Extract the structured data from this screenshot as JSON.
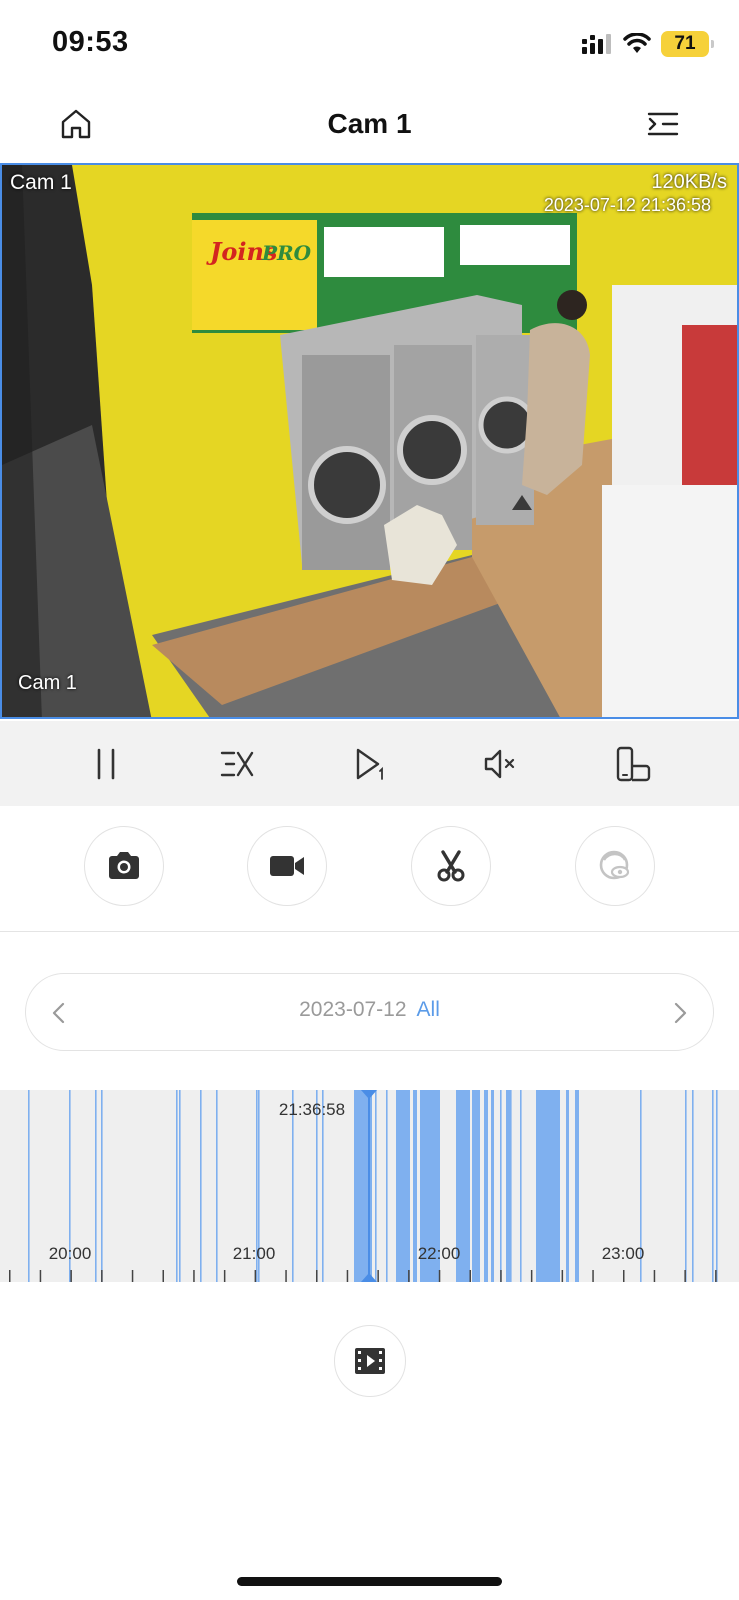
{
  "status_bar": {
    "time": "09:53",
    "battery": "71"
  },
  "nav": {
    "title": "Cam 1"
  },
  "video": {
    "channel_label_top": "Cam 1",
    "channel_label_bottom": "Cam 1",
    "bitrate": "120KB/s",
    "timestamp": "2023-07-12 21:36:58"
  },
  "date_selector": {
    "date": "2023-07-12",
    "filter": "All"
  },
  "timeline": {
    "current_time": "21:36:58",
    "hour_labels": [
      "20:00",
      "21:00",
      "22:00",
      "23:00"
    ]
  },
  "colors": {
    "accent": "#4a8de6",
    "recording": "#7fb0ef",
    "battery": "#f6d13a"
  },
  "icons": {
    "control_bar": [
      "pause-icon",
      "playback-speed-icon",
      "step-frame-icon",
      "mute-icon",
      "rotate-fullscreen-icon"
    ],
    "actions": [
      "camera-snapshot-icon",
      "video-record-icon",
      "scissors-clip-icon",
      "privacy-eye-icon"
    ],
    "bottom": "video-clip-icon"
  }
}
